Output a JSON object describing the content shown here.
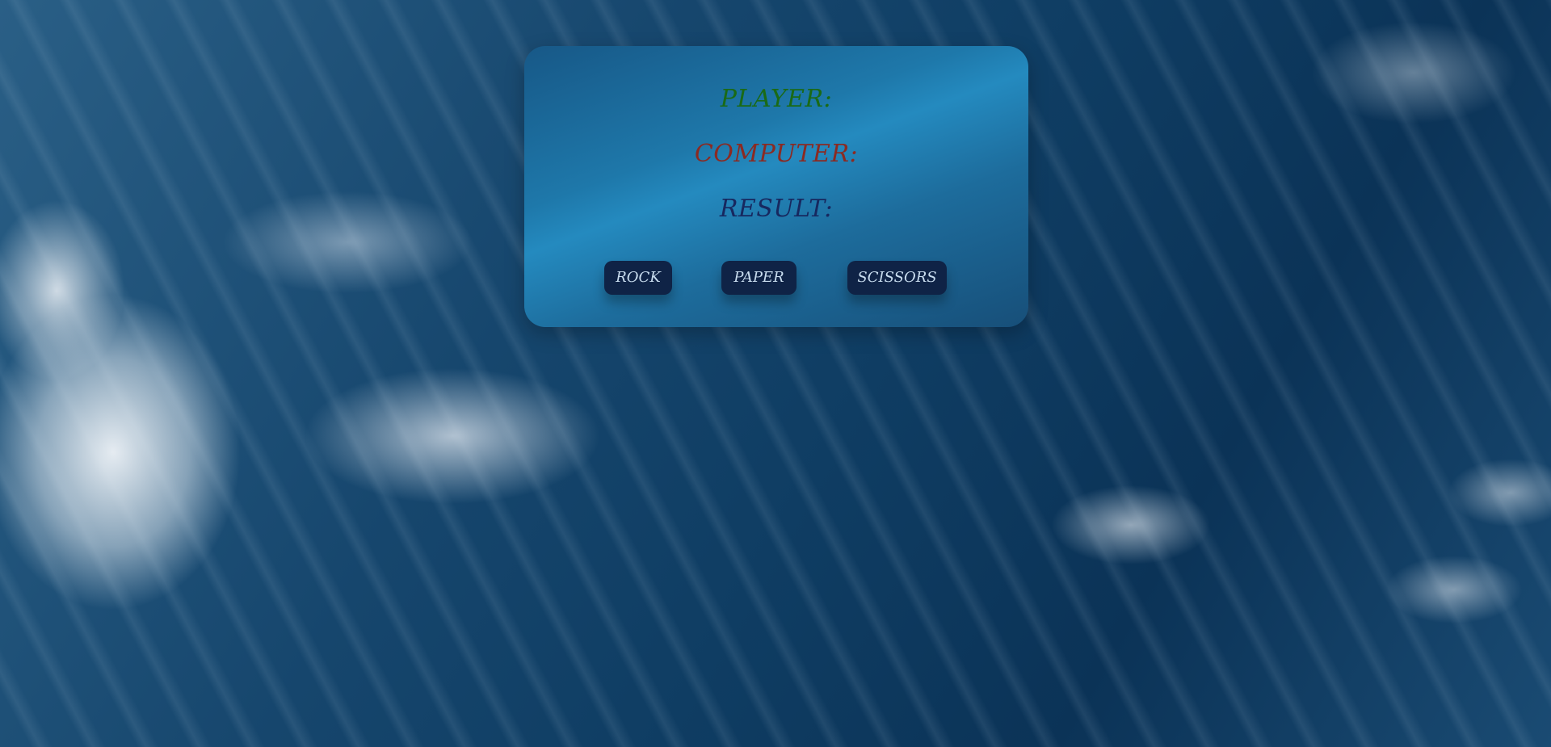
{
  "game": {
    "player_label": "PLAYER:",
    "computer_label": "COMPUTER:",
    "result_label": "RESULT:"
  },
  "buttons": {
    "rock": "ROCK",
    "paper": "PAPER",
    "scissors": "SCISSORS"
  },
  "colors": {
    "player": "#1a6a16",
    "computer": "#8b2a22",
    "result": "#17285f",
    "button_bg": "#0f2346",
    "card_accent": "#248abf"
  }
}
